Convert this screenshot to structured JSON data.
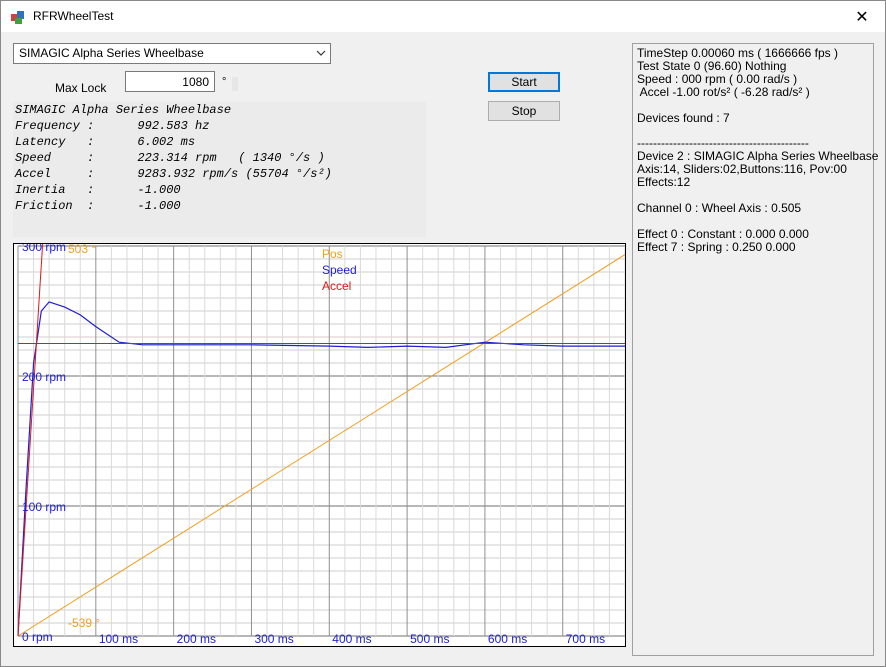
{
  "window": {
    "title": "RFRWheelTest",
    "close_glyph": "✕"
  },
  "device_select": {
    "value": "SIMAGIC Alpha Series Wheelbase"
  },
  "max_lock": {
    "label": "Max Lock",
    "value": "1080",
    "unit": "°"
  },
  "buttons": {
    "start": "Start",
    "stop": "Stop"
  },
  "info_panel": {
    "rows": [
      "SIMAGIC Alpha Series Wheelbase",
      "Frequency :      992.583 hz",
      "Latency   :      6.002 ms",
      "Speed     :      223.314 rpm   ( 1340 °/s )",
      "Accel     :      9283.932 rpm/s (55704 °/s²)",
      "Inertia   :      -1.000",
      "Friction  :      -1.000"
    ]
  },
  "chart": {
    "legend": [
      "Pos",
      "Speed",
      "Accel"
    ],
    "y_labels": [
      "300 rpm",
      "200 rpm",
      "100 rpm",
      "0 rpm"
    ],
    "x_labels": [
      "100 ms",
      "200 ms",
      "300 ms",
      "400 ms",
      "500 ms",
      "600 ms",
      "700 ms"
    ],
    "pos_top_label": "503 °",
    "pos_bottom_label": "-539 °",
    "colors": {
      "pos": "#f0a020",
      "speed": "#1e1ed2",
      "accel": "#e01818"
    }
  },
  "chart_data": {
    "type": "line",
    "title": "",
    "xlabel": "",
    "ylabel": "",
    "x_ticks_ms": [
      100,
      200,
      300,
      400,
      500,
      600,
      700
    ],
    "y_ticks_rpm": [
      0,
      100,
      200,
      300
    ],
    "xlim_ms": [
      0,
      780
    ],
    "ylim_rpm": [
      0,
      300
    ],
    "pos_range_deg": [
      -539,
      503
    ],
    "series": [
      {
        "name": "Pos",
        "x_ms": [
          0,
          780
        ],
        "y_deg": [
          -539,
          480
        ]
      },
      {
        "name": "Speed",
        "x_ms": [
          0,
          10,
          20,
          30,
          40,
          60,
          80,
          100,
          130,
          160,
          200,
          300,
          400,
          450,
          500,
          550,
          600,
          650,
          700,
          780
        ],
        "y_rpm": [
          0,
          110,
          210,
          250,
          257,
          253,
          247,
          238,
          226,
          224,
          224,
          224,
          223,
          222,
          223,
          222,
          226,
          224,
          223,
          223
        ]
      },
      {
        "name": "Accel",
        "x_ms": [
          0,
          32
        ],
        "y_rpm": [
          0,
          305
        ]
      },
      {
        "name": "Accel",
        "x_ms": [
          0,
          780
        ],
        "y_rpm": [
          225,
          225
        ]
      }
    ]
  },
  "status_panel": {
    "lines": [
      "TimeStep 0.00060 ms ( 1666666 fps )",
      "Test State 0 (96.60) Nothing",
      "Speed : 000 rpm ( 0.00 rad/s )",
      " Accel -1.00 rot/s² ( -6.28 rad/s² )",
      "",
      "Devices found : 7",
      "",
      "-------------------------------------------",
      "Device 2 : SIMAGIC Alpha Series Wheelbase",
      "Axis:14, Sliders:02,Buttons:116, Pov:00",
      "Effects:12",
      "",
      "Channel 0 : Wheel Axis : 0.505",
      "",
      "Effect 0 : Constant : 0.000 0.000",
      "Effect 7 : Spring : 0.250 0.000"
    ]
  }
}
